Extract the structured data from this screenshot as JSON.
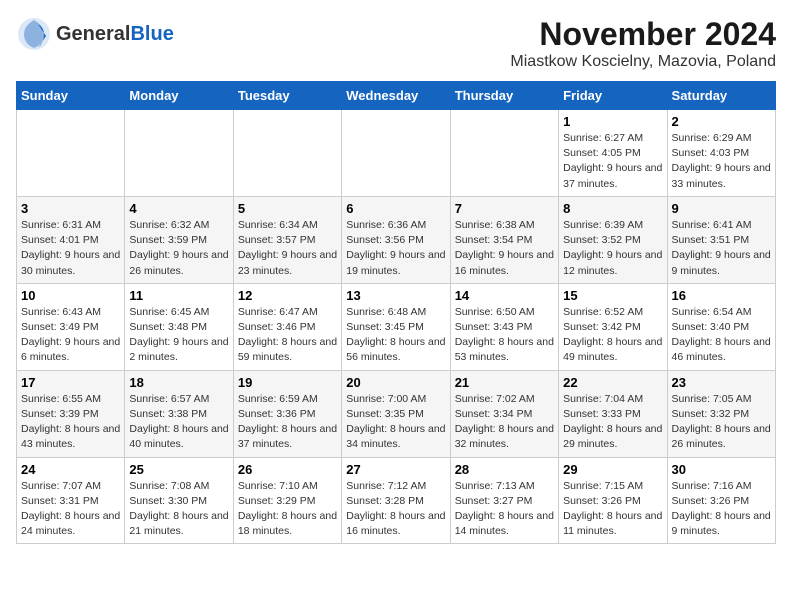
{
  "header": {
    "logo_general": "General",
    "logo_blue": "Blue",
    "title": "November 2024",
    "subtitle": "Miastkow Koscielny, Mazovia, Poland"
  },
  "calendar": {
    "days_of_week": [
      "Sunday",
      "Monday",
      "Tuesday",
      "Wednesday",
      "Thursday",
      "Friday",
      "Saturday"
    ],
    "weeks": [
      [
        {
          "day": "",
          "detail": ""
        },
        {
          "day": "",
          "detail": ""
        },
        {
          "day": "",
          "detail": ""
        },
        {
          "day": "",
          "detail": ""
        },
        {
          "day": "",
          "detail": ""
        },
        {
          "day": "1",
          "detail": "Sunrise: 6:27 AM\nSunset: 4:05 PM\nDaylight: 9 hours and 37 minutes."
        },
        {
          "day": "2",
          "detail": "Sunrise: 6:29 AM\nSunset: 4:03 PM\nDaylight: 9 hours and 33 minutes."
        }
      ],
      [
        {
          "day": "3",
          "detail": "Sunrise: 6:31 AM\nSunset: 4:01 PM\nDaylight: 9 hours and 30 minutes."
        },
        {
          "day": "4",
          "detail": "Sunrise: 6:32 AM\nSunset: 3:59 PM\nDaylight: 9 hours and 26 minutes."
        },
        {
          "day": "5",
          "detail": "Sunrise: 6:34 AM\nSunset: 3:57 PM\nDaylight: 9 hours and 23 minutes."
        },
        {
          "day": "6",
          "detail": "Sunrise: 6:36 AM\nSunset: 3:56 PM\nDaylight: 9 hours and 19 minutes."
        },
        {
          "day": "7",
          "detail": "Sunrise: 6:38 AM\nSunset: 3:54 PM\nDaylight: 9 hours and 16 minutes."
        },
        {
          "day": "8",
          "detail": "Sunrise: 6:39 AM\nSunset: 3:52 PM\nDaylight: 9 hours and 12 minutes."
        },
        {
          "day": "9",
          "detail": "Sunrise: 6:41 AM\nSunset: 3:51 PM\nDaylight: 9 hours and 9 minutes."
        }
      ],
      [
        {
          "day": "10",
          "detail": "Sunrise: 6:43 AM\nSunset: 3:49 PM\nDaylight: 9 hours and 6 minutes."
        },
        {
          "day": "11",
          "detail": "Sunrise: 6:45 AM\nSunset: 3:48 PM\nDaylight: 9 hours and 2 minutes."
        },
        {
          "day": "12",
          "detail": "Sunrise: 6:47 AM\nSunset: 3:46 PM\nDaylight: 8 hours and 59 minutes."
        },
        {
          "day": "13",
          "detail": "Sunrise: 6:48 AM\nSunset: 3:45 PM\nDaylight: 8 hours and 56 minutes."
        },
        {
          "day": "14",
          "detail": "Sunrise: 6:50 AM\nSunset: 3:43 PM\nDaylight: 8 hours and 53 minutes."
        },
        {
          "day": "15",
          "detail": "Sunrise: 6:52 AM\nSunset: 3:42 PM\nDaylight: 8 hours and 49 minutes."
        },
        {
          "day": "16",
          "detail": "Sunrise: 6:54 AM\nSunset: 3:40 PM\nDaylight: 8 hours and 46 minutes."
        }
      ],
      [
        {
          "day": "17",
          "detail": "Sunrise: 6:55 AM\nSunset: 3:39 PM\nDaylight: 8 hours and 43 minutes."
        },
        {
          "day": "18",
          "detail": "Sunrise: 6:57 AM\nSunset: 3:38 PM\nDaylight: 8 hours and 40 minutes."
        },
        {
          "day": "19",
          "detail": "Sunrise: 6:59 AM\nSunset: 3:36 PM\nDaylight: 8 hours and 37 minutes."
        },
        {
          "day": "20",
          "detail": "Sunrise: 7:00 AM\nSunset: 3:35 PM\nDaylight: 8 hours and 34 minutes."
        },
        {
          "day": "21",
          "detail": "Sunrise: 7:02 AM\nSunset: 3:34 PM\nDaylight: 8 hours and 32 minutes."
        },
        {
          "day": "22",
          "detail": "Sunrise: 7:04 AM\nSunset: 3:33 PM\nDaylight: 8 hours and 29 minutes."
        },
        {
          "day": "23",
          "detail": "Sunrise: 7:05 AM\nSunset: 3:32 PM\nDaylight: 8 hours and 26 minutes."
        }
      ],
      [
        {
          "day": "24",
          "detail": "Sunrise: 7:07 AM\nSunset: 3:31 PM\nDaylight: 8 hours and 24 minutes."
        },
        {
          "day": "25",
          "detail": "Sunrise: 7:08 AM\nSunset: 3:30 PM\nDaylight: 8 hours and 21 minutes."
        },
        {
          "day": "26",
          "detail": "Sunrise: 7:10 AM\nSunset: 3:29 PM\nDaylight: 8 hours and 18 minutes."
        },
        {
          "day": "27",
          "detail": "Sunrise: 7:12 AM\nSunset: 3:28 PM\nDaylight: 8 hours and 16 minutes."
        },
        {
          "day": "28",
          "detail": "Sunrise: 7:13 AM\nSunset: 3:27 PM\nDaylight: 8 hours and 14 minutes."
        },
        {
          "day": "29",
          "detail": "Sunrise: 7:15 AM\nSunset: 3:26 PM\nDaylight: 8 hours and 11 minutes."
        },
        {
          "day": "30",
          "detail": "Sunrise: 7:16 AM\nSunset: 3:26 PM\nDaylight: 8 hours and 9 minutes."
        }
      ]
    ]
  }
}
